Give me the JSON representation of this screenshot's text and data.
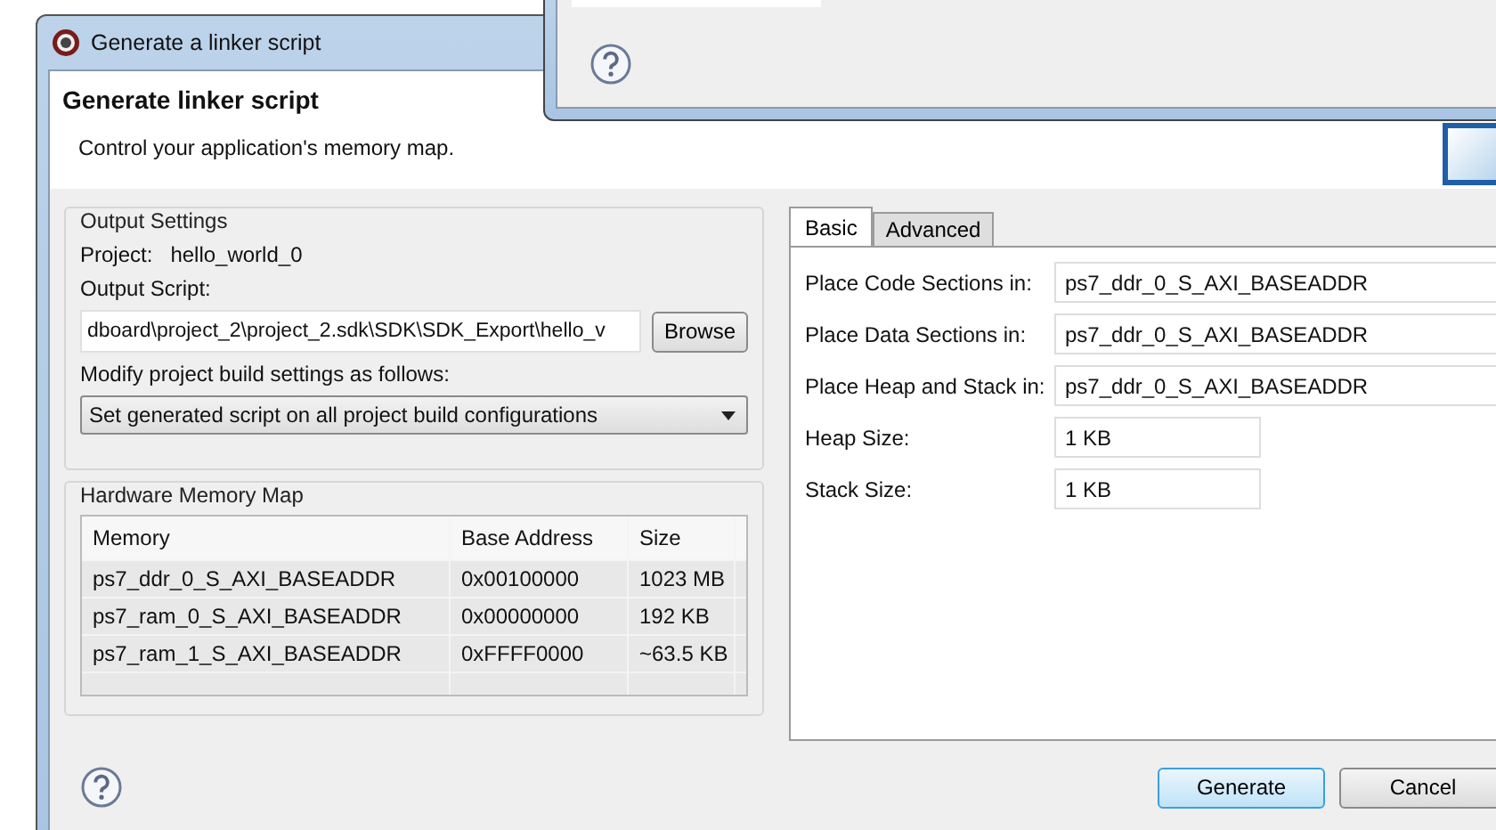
{
  "window": {
    "title": "Generate a linker script"
  },
  "background_window": {
    "kind": "help"
  },
  "header": {
    "title": "Generate linker script",
    "subtitle": "Control your application's memory map."
  },
  "output_settings": {
    "title": "Output Settings",
    "project_label": "Project:",
    "project": "hello_world_0",
    "script_label": "Output Script:",
    "script_path": "dboard\\project_2\\project_2.sdk\\SDK\\SDK_Export\\hello_v",
    "browse": "Browse",
    "modify_label": "Modify project build settings as follows:",
    "modify_choice": "Set generated script on all project build configurations"
  },
  "memory_map": {
    "title": "Hardware Memory Map",
    "columns": [
      "Memory",
      "Base Address",
      "Size"
    ],
    "rows": [
      [
        "ps7_ddr_0_S_AXI_BASEADDR",
        "0x00100000",
        "1023 MB"
      ],
      [
        "ps7_ram_0_S_AXI_BASEADDR",
        "0x00000000",
        "192 KB"
      ],
      [
        "ps7_ram_1_S_AXI_BASEADDR",
        "0xFFFF0000",
        "~63.5 KB"
      ]
    ]
  },
  "tabs": [
    {
      "label": "Basic",
      "selected": true
    },
    {
      "label": "Advanced",
      "selected": false
    }
  ],
  "fields": [
    {
      "label": "Place Code Sections in:",
      "value": "ps7_ddr_0_S_AXI_BASEADDR",
      "kind": "wide"
    },
    {
      "label": "Place Data Sections in:",
      "value": "ps7_ddr_0_S_AXI_BASEADDR",
      "kind": "wide"
    },
    {
      "label": "Place Heap and Stack in:",
      "value": "ps7_ddr_0_S_AXI_BASEADDR",
      "kind": "wide"
    },
    {
      "label": "Heap Size:",
      "value": "1 KB",
      "kind": "narrow"
    },
    {
      "label": "Stack Size:",
      "value": "1 KB",
      "kind": "narrow"
    }
  ],
  "buttons": [
    {
      "label": "Generate",
      "default": true
    },
    {
      "label": "Cancel",
      "default": false
    }
  ]
}
